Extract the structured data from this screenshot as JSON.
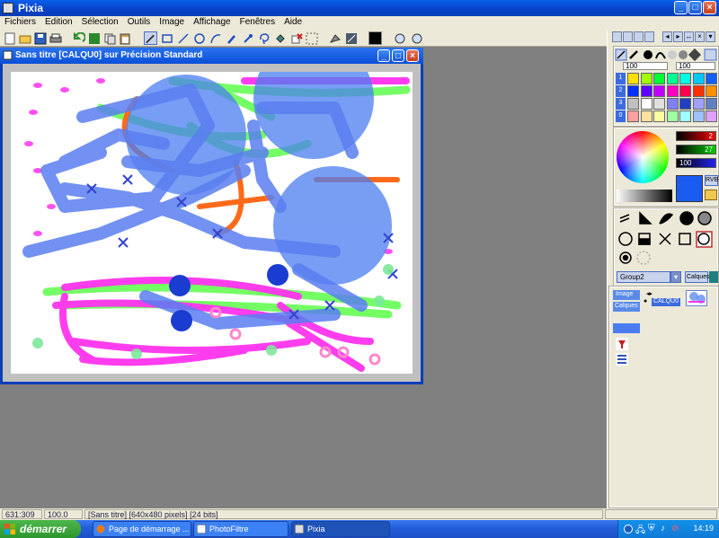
{
  "app": {
    "title": "Pixia"
  },
  "menu": [
    "Fichiers",
    "Edition",
    "Sélection",
    "Outils",
    "Image",
    "Affichage",
    "Fenêtres",
    "Aide"
  ],
  "canvas_window": {
    "title": "Sans titre [CALQU0] sur Précision Standard"
  },
  "right_panel": {
    "brush_sizes": [
      "100",
      "100"
    ],
    "palette_rows": [
      "1",
      "2",
      "3",
      "0"
    ],
    "color_values": {
      "r": "2",
      "g": "27",
      "b": "100"
    },
    "rgb_label": "RVB",
    "layer_group": "Group2",
    "layers_button": "Calques",
    "image_tab": "Image",
    "layers_tab": "Calques",
    "layer_name": "CALQU0"
  },
  "status": {
    "coords": "631:309",
    "zoom": "100.0",
    "info": "[Sans titre] [640x480 pixels] [24 bits]"
  },
  "taskbar": {
    "start": "démarrer",
    "tasks": [
      "Page de démarrage ...",
      "PhotoFiltre",
      "Pixia"
    ],
    "clock": "14:19"
  },
  "colors": {
    "xp_blue": "#0a5fe8",
    "panel": "#ece9d8",
    "paint_blue": "#4a7ef0",
    "paint_magenta": "#ff33ee",
    "paint_green": "#66ff55",
    "paint_orange": "#ff6a1a",
    "fg_color": "#000000",
    "selected_color": "#1a5cf0"
  }
}
